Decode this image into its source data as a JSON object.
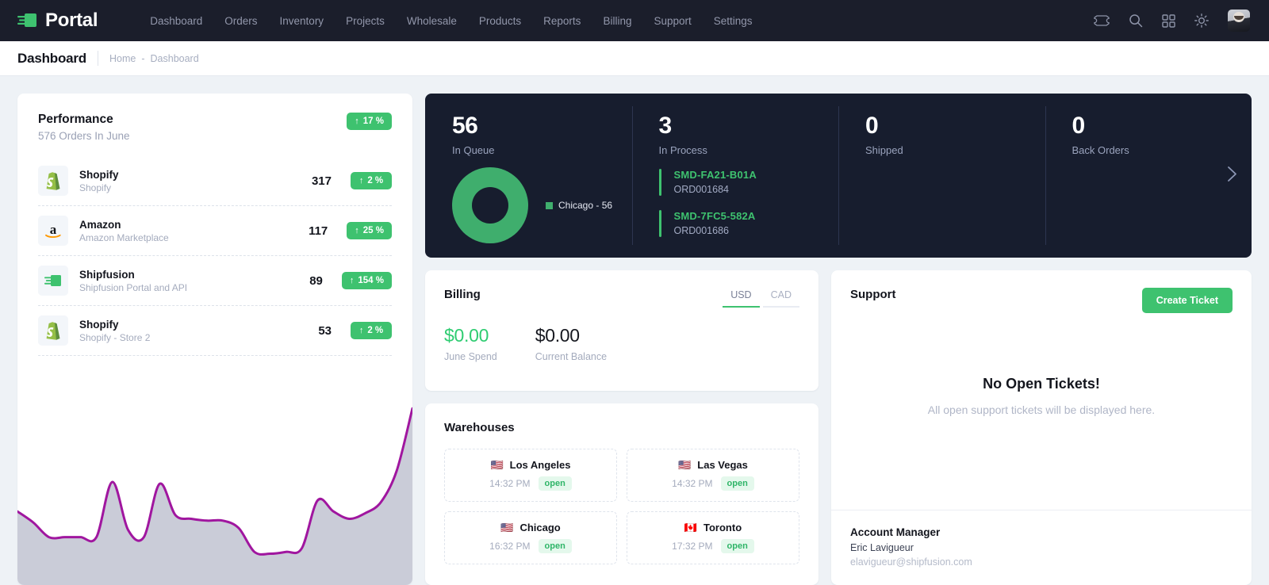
{
  "nav": {
    "brand": "Portal",
    "links": [
      "Dashboard",
      "Orders",
      "Inventory",
      "Projects",
      "Wholesale",
      "Products",
      "Reports",
      "Billing",
      "Support",
      "Settings"
    ],
    "icons": [
      "ticket-icon",
      "search-icon",
      "apps-grid-icon",
      "sun-theme-icon",
      "avatar"
    ]
  },
  "header": {
    "title": "Dashboard",
    "breadcrumb": [
      "Home",
      "Dashboard"
    ],
    "separator": "-"
  },
  "performance": {
    "title": "Performance",
    "subtitle": "576 Orders In June",
    "badge": "17 %",
    "rows": [
      {
        "name": "Shopify",
        "desc": "Shopify",
        "value": "317",
        "badge": "2 %",
        "icon": "shopify-icon"
      },
      {
        "name": "Amazon",
        "desc": "Amazon Marketplace",
        "value": "117",
        "badge": "25 %",
        "icon": "amazon-icon"
      },
      {
        "name": "Shipfusion",
        "desc": "Shipfusion Portal and API",
        "value": "89",
        "badge": "154 %",
        "icon": "shipfusion-icon"
      },
      {
        "name": "Shopify",
        "desc": "Shopify - Store 2",
        "value": "53",
        "badge": "2 %",
        "icon": "shopify-icon"
      }
    ]
  },
  "stats": {
    "queue": {
      "value": "56",
      "label": "In Queue"
    },
    "process": {
      "value": "3",
      "label": "In Process"
    },
    "shipped": {
      "value": "0",
      "label": "Shipped"
    },
    "back": {
      "value": "0",
      "label": "Back Orders"
    },
    "legend": "Chicago - 56",
    "orders": [
      {
        "code": "SMD-FA21-B01A",
        "ref": "ORD001684"
      },
      {
        "code": "SMD-7FC5-582A",
        "ref": "ORD001686"
      }
    ]
  },
  "billing": {
    "title": "Billing",
    "currencies": [
      "USD",
      "CAD"
    ],
    "active_currency": "USD",
    "spend_value": "$0.00",
    "spend_label": "June Spend",
    "balance_value": "$0.00",
    "balance_label": "Current Balance"
  },
  "warehouses": {
    "title": "Warehouses",
    "items": [
      {
        "flag": "🇺🇸",
        "name": "Los Angeles",
        "time": "14:32 PM",
        "status": "open"
      },
      {
        "flag": "🇺🇸",
        "name": "Las Vegas",
        "time": "14:32 PM",
        "status": "open"
      },
      {
        "flag": "🇺🇸",
        "name": "Chicago",
        "time": "16:32 PM",
        "status": "open"
      },
      {
        "flag": "🇨🇦",
        "name": "Toronto",
        "time": "17:32 PM",
        "status": "open"
      }
    ]
  },
  "support": {
    "title": "Support",
    "create_label": "Create Ticket",
    "empty_title": "No Open Tickets!",
    "empty_sub": "All open support tickets will be displayed here.",
    "am_title": "Account Manager",
    "am_name": "Eric Lavigueur",
    "am_email": "elavigueur@shipfusion.com"
  },
  "colors": {
    "accent_green": "#3ec26f",
    "donut_green": "#3fae6d",
    "nav_dark": "#1b1e2b",
    "panel_dark": "#171d2e",
    "spark_line": "#a0169f",
    "spark_fill": "#c7c9d6"
  },
  "chart_data": {
    "type": "area",
    "title": "",
    "xlabel": "",
    "ylabel": "",
    "grid": false,
    "legend": "none",
    "x": [
      0,
      1,
      2,
      3,
      4,
      5,
      6,
      7,
      8,
      9,
      10,
      11,
      12,
      13,
      14,
      15,
      16,
      17,
      18,
      19,
      20,
      21,
      22,
      23,
      24
    ],
    "values": [
      40,
      34,
      26,
      26,
      26,
      26,
      56,
      30,
      26,
      55,
      38,
      36,
      35,
      35,
      31,
      18,
      17,
      18,
      20,
      46,
      40,
      36,
      39,
      45,
      62,
      96
    ],
    "ylim": [
      0,
      100
    ],
    "donut": {
      "type": "pie",
      "categories": [
        "Chicago"
      ],
      "values": [
        56
      ],
      "colors": [
        "#3fae6d"
      ],
      "total": 56
    }
  }
}
